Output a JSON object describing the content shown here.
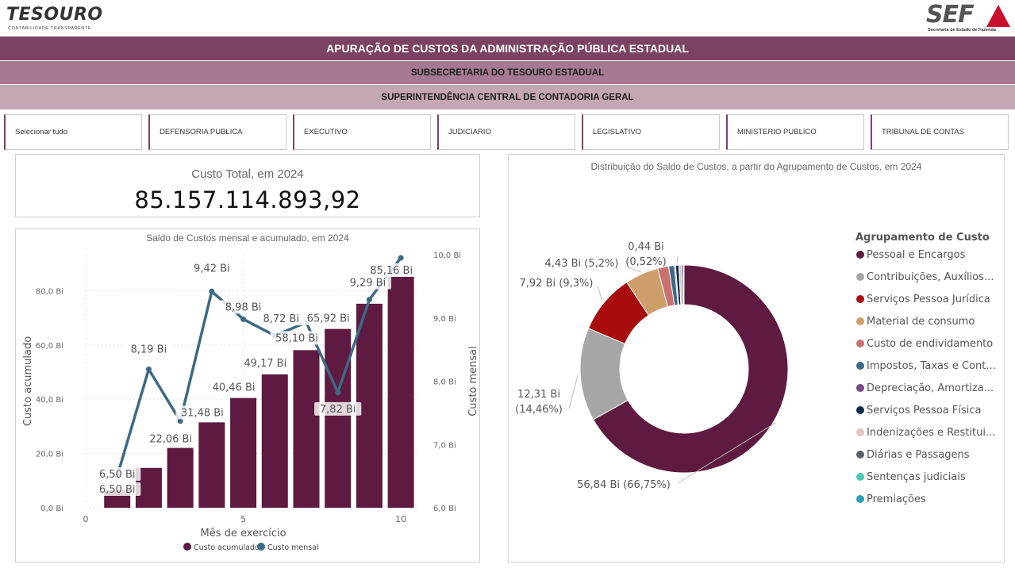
{
  "branding": {
    "left_logo": "TESOURO",
    "left_logo_sub": "CONTABILIDADE TRANSPARENTE",
    "right_logo": "SEF",
    "right_logo_sub": "Secretaria de Estado de Fazenda",
    "accent_color": "#c8102e"
  },
  "header": {
    "title": "APURAÇÃO DE CUSTOS DA ADMINISTRAÇÃO PÚBLICA ESTADUAL",
    "subtitle": "SUBSECRETARIA DO TESOURO ESTADUAL",
    "subtitle2": "SUPERINTENDÊNCIA CENTRAL DE CONTADORIA GERAL"
  },
  "filters": [
    {
      "label": "Selecionar tudo"
    },
    {
      "label": "DEFENSORIA PUBLICA"
    },
    {
      "label": "EXECUTIVO"
    },
    {
      "label": "JUDICIARIO"
    },
    {
      "label": "LEGISLATIVO"
    },
    {
      "label": "MINISTERIO PUBLICO"
    },
    {
      "label": "TRIBUNAL DE CONTAS"
    }
  ],
  "kpi": {
    "title": "Custo Total, em 2024",
    "value": "85.157.114.893,92"
  },
  "chart_data": [
    {
      "type": "bar",
      "title": "Saldo de Custos mensal e acumulado, em 2024",
      "xlabel": "Mês de exercício",
      "ylabel": "Custo acumulado",
      "y2label": "Custo mensal",
      "x_ticks": [
        "0",
        "5",
        "10"
      ],
      "y_ticks": [
        "0,0 Bi",
        "20,0 Bi",
        "40,0 Bi",
        "60,0 Bi",
        "80,0 Bi"
      ],
      "y2_ticks": [
        "6,0 Bi",
        "7,0 Bi",
        "8,0 Bi",
        "9,0 Bi",
        "10,0 Bi"
      ],
      "xlim": [
        0,
        10.5
      ],
      "ylim": [
        0,
        93.3
      ],
      "y2lim": [
        6.0,
        10.0
      ],
      "x": [
        1,
        2,
        3,
        4,
        5,
        6,
        7,
        8,
        9,
        10
      ],
      "series": [
        {
          "name": "Custo acumulado",
          "kind": "bar",
          "color": "#5e1a41",
          "values": [
            6.5,
            14.69,
            22.06,
            31.48,
            40.46,
            49.17,
            58.1,
            65.92,
            75.21,
            85.16
          ],
          "labels": [
            "6,50 Bi",
            "",
            "22,06 Bi",
            "31,48 Bi",
            "40,46 Bi",
            "49,17 Bi",
            "58,10 Bi",
            "65,92 Bi",
            "",
            "85,16 Bi"
          ]
        },
        {
          "name": "Custo mensal",
          "kind": "line",
          "color": "#3d6a85",
          "values": [
            6.5,
            8.19,
            7.37,
            9.42,
            8.98,
            8.72,
            8.93,
            7.82,
            9.29,
            9.95
          ],
          "labels": [
            "6,50 Bi",
            "8,19 Bi",
            "",
            "9,42 Bi",
            "8,98 Bi",
            "8,72 Bi",
            "",
            "7,82 Bi",
            "9,29 Bi",
            ""
          ]
        }
      ],
      "legend_position": "bottom"
    },
    {
      "type": "pie",
      "title": "Distribuição do Saldo de Custos, a partir do Agrupamento de Custos, em 2024",
      "legend_title": "Agrupamento de Custo",
      "legend_position": "right",
      "slices": [
        {
          "name": "Pessoal e Encargos",
          "value": 56.84,
          "percent": 66.75,
          "color": "#5e1a41",
          "label": "56,84 Bi (66,75%)"
        },
        {
          "name": "Contribuições, Auxílios...",
          "value": 12.31,
          "percent": 14.46,
          "color": "#a6a6a6",
          "label": "12,31 Bi (14,46%)"
        },
        {
          "name": "Serviços Pessoa Jurídica",
          "value": 7.92,
          "percent": 9.3,
          "color": "#a80c0c",
          "label": "7,92 Bi (9,3%)"
        },
        {
          "name": "Material de consumo",
          "value": 4.43,
          "percent": 5.2,
          "color": "#cf9f6b",
          "label": "4,43 Bi (5,2%)"
        },
        {
          "name": "Custo de endividamento",
          "value": 1.45,
          "percent": 1.7,
          "color": "#c97171",
          "label": ""
        },
        {
          "name": "Impostos, Taxas e Cont...",
          "value": 0.75,
          "percent": 0.88,
          "color": "#3d6a85",
          "label": ""
        },
        {
          "name": "Depreciação, Amortiza...",
          "value": 0.15,
          "percent": 0.18,
          "color": "#7b4a87",
          "label": ""
        },
        {
          "name": "Serviços Pessoa Física",
          "value": 0.44,
          "percent": 0.52,
          "color": "#0d2c4a",
          "label": "0,44 Bi (0,52%)"
        },
        {
          "name": "Indenizações e Restitui...",
          "value": 0.35,
          "percent": 0.41,
          "color": "#e3c3c7",
          "label": ""
        },
        {
          "name": "Diárias e Passagens",
          "value": 0.25,
          "percent": 0.29,
          "color": "#5a6167",
          "label": ""
        },
        {
          "name": "Sentenças judiciais",
          "value": 0.05,
          "percent": 0.06,
          "color": "#4cc9b5",
          "label": ""
        },
        {
          "name": "Premiações",
          "value": 0.03,
          "percent": 0.04,
          "color": "#2e9fb3",
          "label": ""
        }
      ]
    }
  ]
}
